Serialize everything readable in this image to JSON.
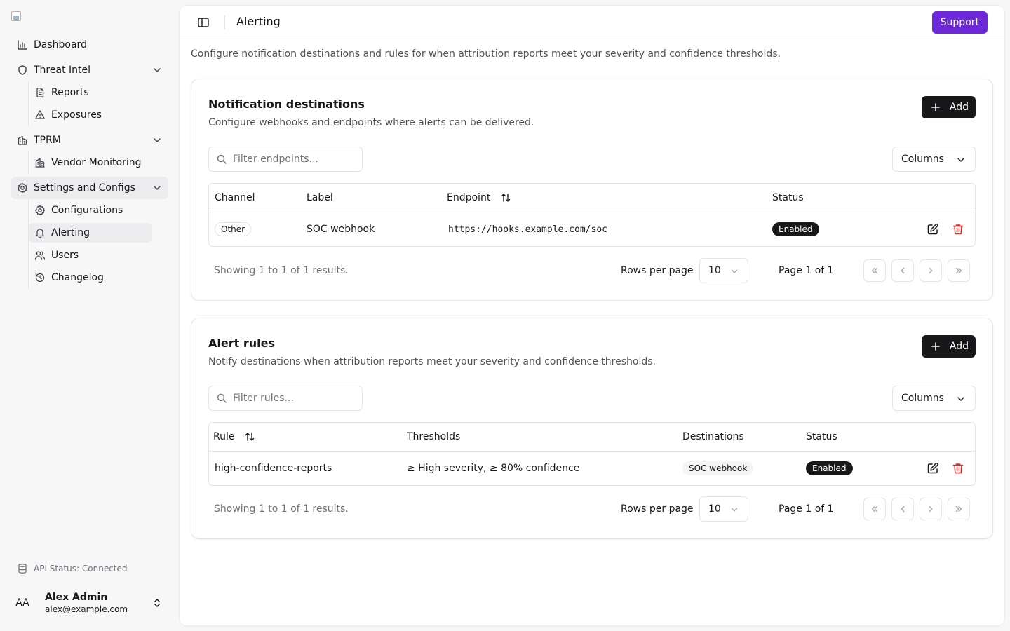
{
  "sidebar": {
    "logo_alt": "",
    "items": [
      {
        "label": "Dashboard"
      },
      {
        "label": "Threat Intel"
      },
      {
        "label": "Reports"
      },
      {
        "label": "Exposures"
      },
      {
        "label": "TPRM"
      },
      {
        "label": "Vendor Monitoring"
      },
      {
        "label": "Settings and Configs"
      },
      {
        "label": "Configurations"
      },
      {
        "label": "Alerting"
      },
      {
        "label": "Users"
      },
      {
        "label": "Changelog"
      }
    ],
    "api_status": "API Status: Connected",
    "user": {
      "initials": "AA",
      "name": "Alex Admin",
      "email": "alex@example.com"
    }
  },
  "header": {
    "title": "Alerting",
    "support_label": "Support"
  },
  "page": {
    "description": "Configure notification destinations and rules for when attribution reports meet your severity and confidence thresholds."
  },
  "destinations": {
    "title": "Notification destinations",
    "description": "Configure webhooks and endpoints where alerts can be delivered.",
    "add_label": "Add",
    "filter_placeholder": "Filter endpoints...",
    "columns_label": "Columns",
    "headers": [
      "Channel",
      "Label",
      "Endpoint",
      "Status"
    ],
    "rows": [
      {
        "channel": "Other",
        "label": "SOC webhook",
        "endpoint": "https://hooks.example.com/soc",
        "status": "Enabled"
      }
    ],
    "footer": {
      "showing": "Showing 1 to 1 of 1 results.",
      "rows_per_page_label": "Rows per page",
      "rows_per_page": "10",
      "page": "Page 1 of 1"
    }
  },
  "rules": {
    "title": "Alert rules",
    "description": "Notify destinations when attribution reports meet your severity and confidence thresholds.",
    "add_label": "Add",
    "filter_placeholder": "Filter rules...",
    "columns_label": "Columns",
    "headers": [
      "Rule",
      "Thresholds",
      "Destinations",
      "Status"
    ],
    "rows": [
      {
        "rule": "high-confidence-reports",
        "thresholds": "≥ High severity, ≥ 80% confidence",
        "destinations": "SOC webhook",
        "status": "Enabled"
      }
    ],
    "footer": {
      "showing": "Showing 1 to 1 of 1 results.",
      "rows_per_page_label": "Rows per page",
      "rows_per_page": "10",
      "page": "Page 1 of 1"
    }
  },
  "colors": {
    "accent": "#6d28d9",
    "danger": "#dc2626",
    "dark": "#18181b"
  }
}
